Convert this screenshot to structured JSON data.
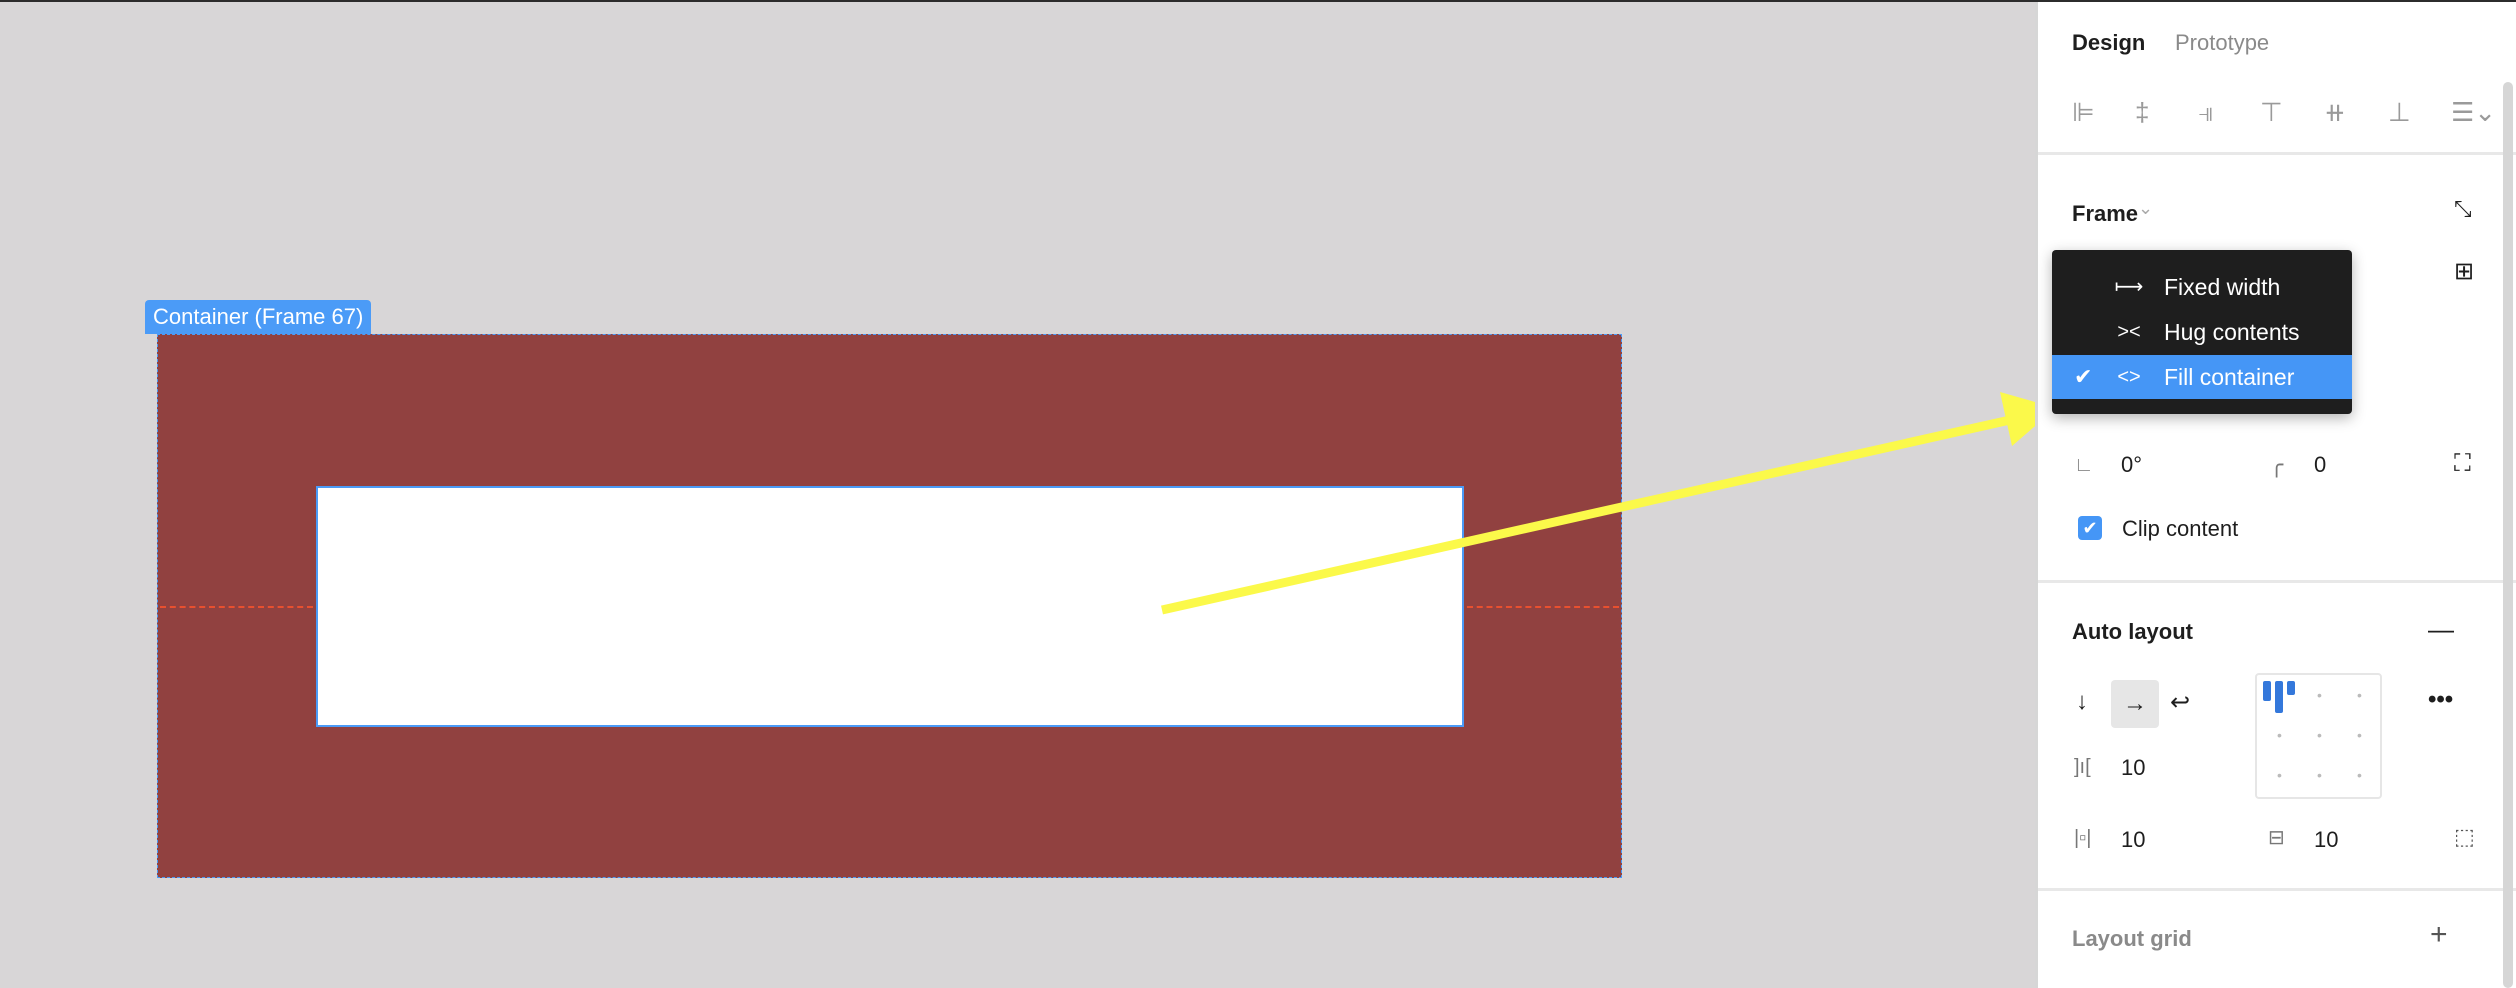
{
  "canvas": {
    "frame_label": "Container (Frame 67)",
    "frame_color": "#914140",
    "selection_color": "#4b9bf7"
  },
  "panel": {
    "tabs": [
      {
        "label": "Design",
        "active": true
      },
      {
        "label": "Prototype",
        "active": false
      }
    ],
    "align_icons": [
      "align-left-icon",
      "align-horizontal-center-icon",
      "align-right-icon",
      "align-top-icon",
      "align-vertical-center-icon",
      "align-bottom-icon",
      "distribute-icon"
    ],
    "frame": {
      "title": "Frame",
      "rotation": "0°",
      "corner_radius": "0",
      "clip_content_label": "Clip content",
      "clip_content": true
    },
    "width_menu": {
      "items": [
        {
          "label": "Fixed width",
          "icon": "fixed-width-icon",
          "selected": false
        },
        {
          "label": "Hug contents",
          "icon": "hug-contents-icon",
          "selected": false
        },
        {
          "label": "Fill container",
          "icon": "fill-container-icon",
          "selected": true
        }
      ]
    },
    "auto_layout": {
      "title": "Auto layout",
      "direction": "horizontal",
      "gap": "10",
      "padding_horizontal": "10",
      "padding_vertical": "10",
      "alignment": "top-left"
    },
    "layout_grid": {
      "title": "Layout grid"
    }
  },
  "annotation": {
    "arrow_color": "#fbf94a"
  }
}
